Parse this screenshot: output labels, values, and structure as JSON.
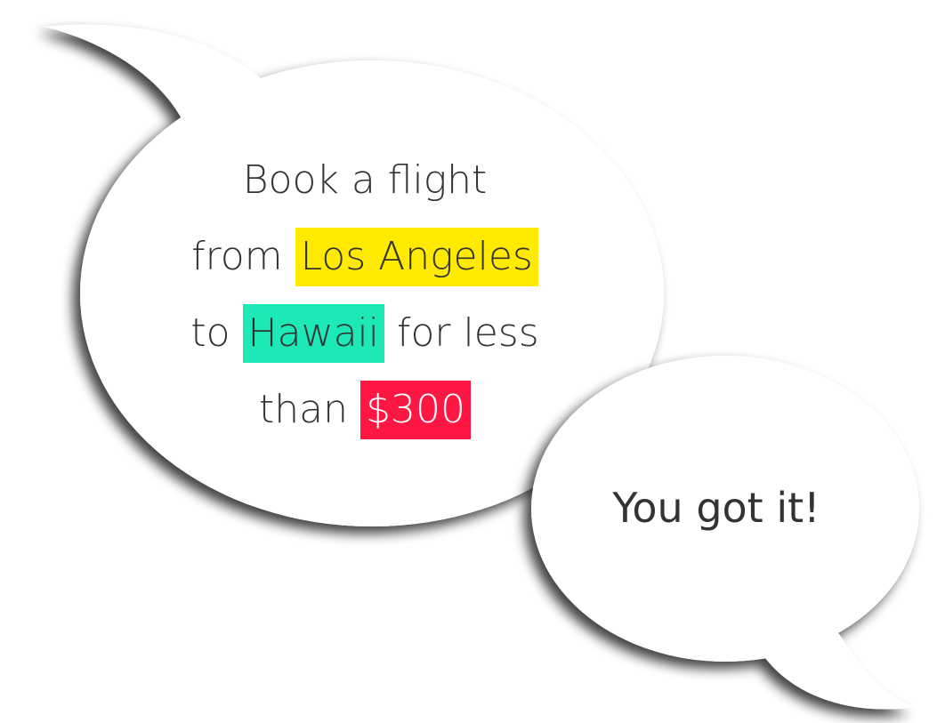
{
  "request_bubble": {
    "line1": "Book a flight",
    "line2_prefix": "from ",
    "origin": "Los Angeles",
    "line3_prefix": "to ",
    "destination": "Hawaii",
    "line3_suffix": " for less",
    "line4_prefix": "than ",
    "price": "$300"
  },
  "reply_bubble": {
    "text": "You got it!"
  },
  "colors": {
    "origin_highlight": "#ffea00",
    "destination_highlight": "#1de9b6",
    "price_highlight": "#ff1744",
    "text": "#333333",
    "bubble_fill": "#ffffff"
  }
}
